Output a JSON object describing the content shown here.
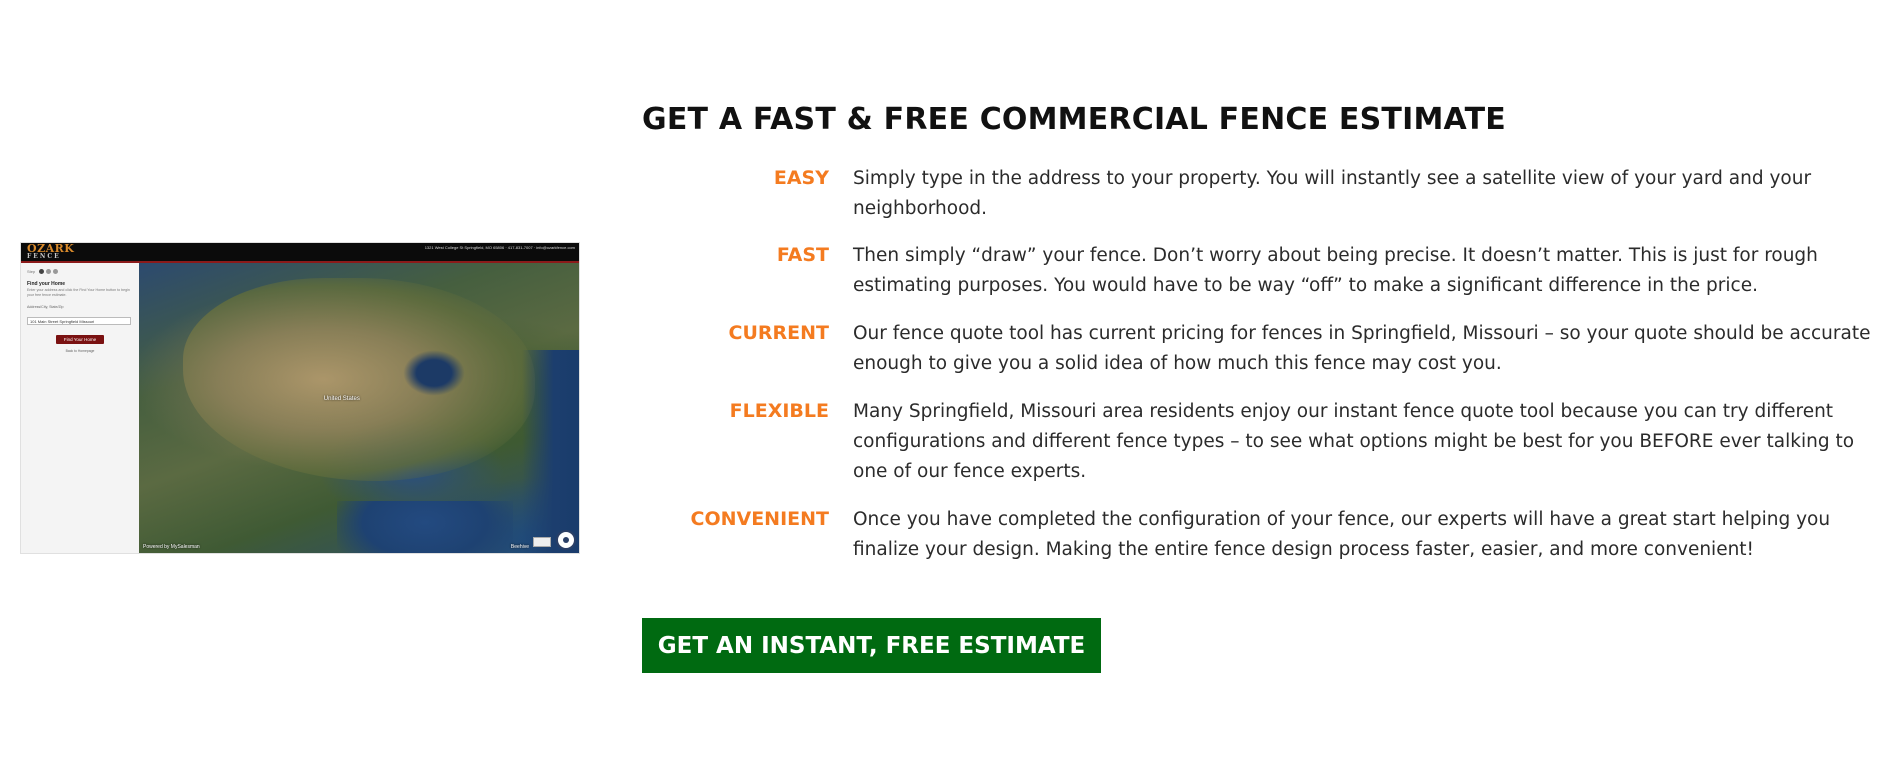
{
  "preview": {
    "logo_main": "OZARK",
    "logo_sub": "FENCE",
    "top_info": "1321 West College St Springfield, MO 65806 · 417-831-7007 · info@ozarkfence.com",
    "steps_label": "Step",
    "panel_title": "Find your Home",
    "panel_desc": "Enter your address and click the Find Your Home button to begin your free fence estimate.",
    "address_label": "Address/City, State/Zip",
    "address_value": "101 Main Street Springfield Missouri",
    "find_button": "Find Your Home",
    "back_link": "Back to Homepage",
    "map_label_country": "United States",
    "map_attr_left": "Powered by MySalesman",
    "map_attr_right": "Beehive"
  },
  "title": "GET A FAST & FREE COMMERCIAL FENCE ESTIMATE",
  "features": [
    {
      "term": "EASY",
      "desc": "Simply type in the address to your property. You will instantly see a satellite view of your yard and your neighborhood."
    },
    {
      "term": "FAST",
      "desc": "Then simply “draw” your fence. Don’t worry about being precise. It doesn’t matter. This is just for rough estimating purposes. You would have to be way “off” to make a significant difference in the price."
    },
    {
      "term": "CURRENT",
      "desc": "Our fence quote tool has current pricing for fences in Springfield, Missouri – so your quote should be accurate enough to give you a solid idea of how much this fence may cost you."
    },
    {
      "term": "FLEXIBLE",
      "desc": "Many Springfield, Missouri area residents enjoy our instant fence quote tool because you can try different configurations and different fence types – to see what options might be best for you BEFORE ever talking to one of our fence experts."
    },
    {
      "term": "CONVENIENT",
      "desc": "Once you have completed the configuration of your fence, our experts will have a great start helping you finalize your design. Making the entire fence design process faster, easier, and more convenient!"
    }
  ],
  "cta_label": "GET AN INSTANT, FREE ESTIMATE",
  "colors": {
    "accent": "#f47b20",
    "cta": "#006a11",
    "text": "#2b2b2b"
  }
}
